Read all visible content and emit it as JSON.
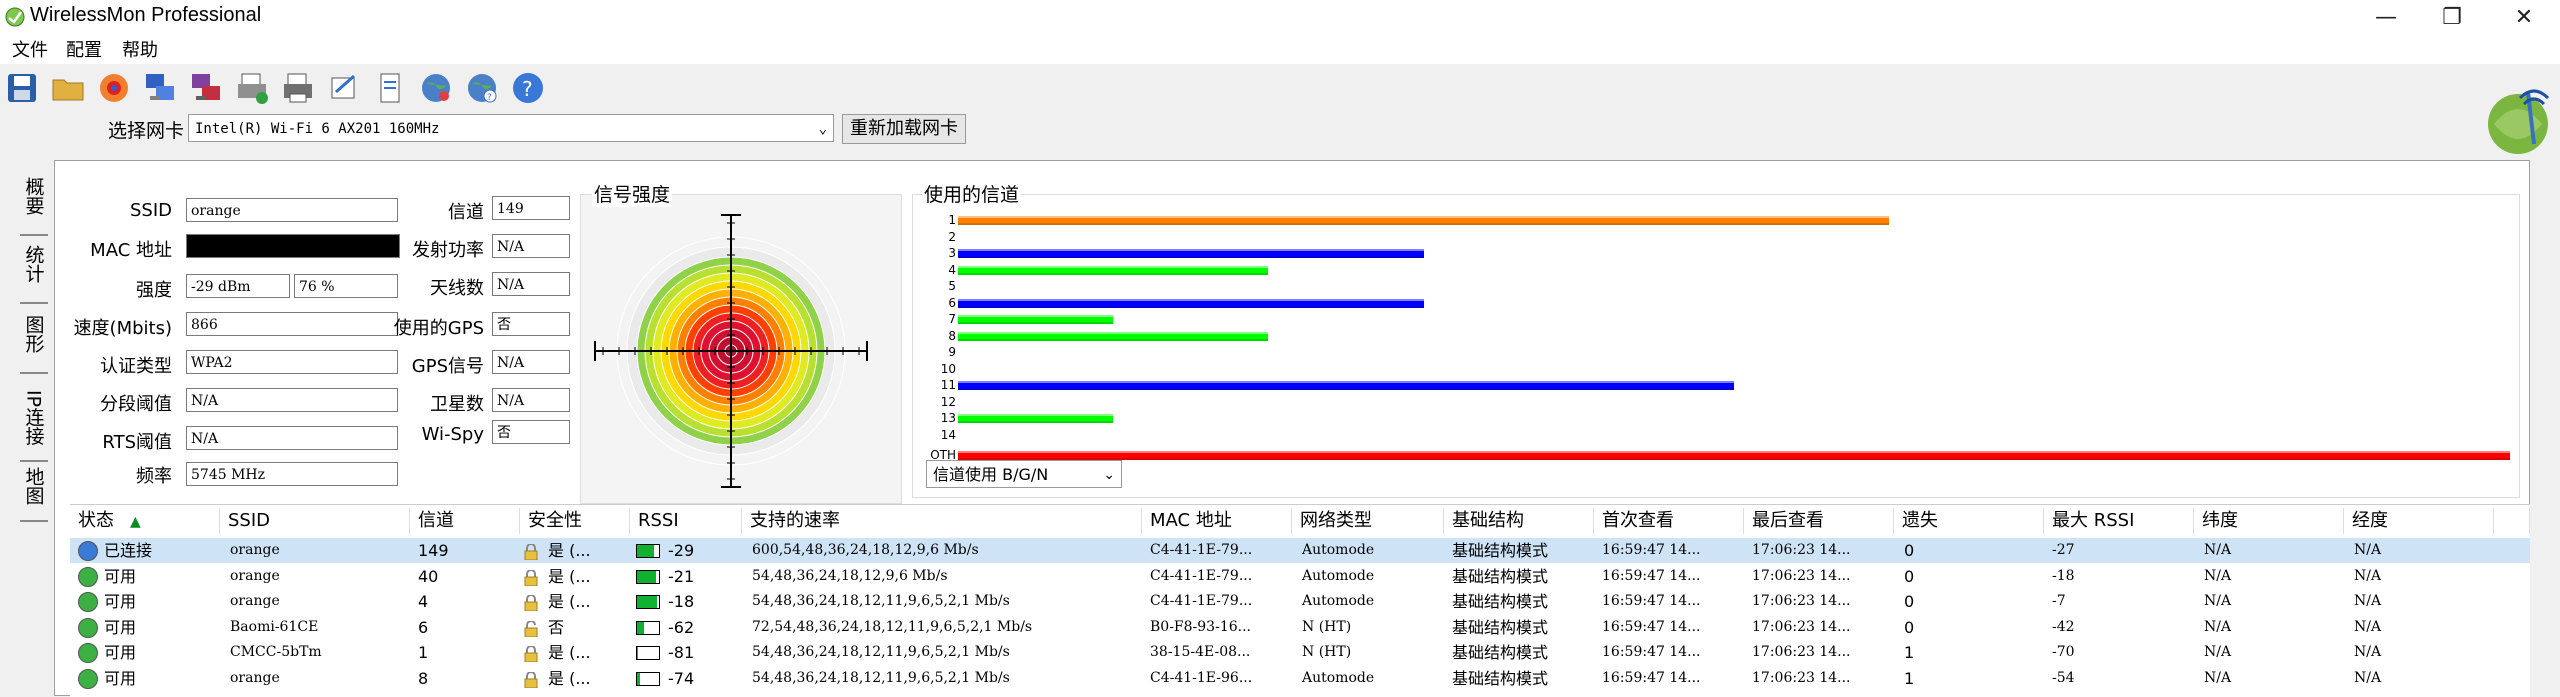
{
  "window": {
    "title": "WirelessMon Professional",
    "minimize": "—",
    "restore": "❐",
    "close": "✕"
  },
  "menu": [
    "文件",
    "配置",
    "帮助"
  ],
  "toolbar": {
    "icons": [
      "save-icon",
      "open-folder-icon",
      "record-icon",
      "network-icon",
      "network-color-icon",
      "print-icon",
      "printer-icon",
      "wizard-icon",
      "document-icon",
      "globe-icon",
      "globe-help-icon",
      "help-icon"
    ]
  },
  "adapter": {
    "label": "选择网卡",
    "value": "Intel(R) Wi-Fi 6 AX201 160MHz",
    "reload": "重新加载网卡"
  },
  "tabs": [
    "概要",
    "统计",
    "图形",
    "IP连接",
    "地图"
  ],
  "info": {
    "ssid_label": "SSID",
    "ssid": "orange",
    "mac_label": "MAC 地址",
    "mac": "",
    "strength_label": "强度",
    "strength_dbm": "-29 dBm",
    "strength_pct": "76 %",
    "speed_label": "速度(Mbits)",
    "speed": "866",
    "auth_label": "认证类型",
    "auth": "WPA2",
    "frag_label": "分段阈值",
    "frag": "N/A",
    "rts_label": "RTS阈值",
    "rts": "N/A",
    "freq_label": "频率",
    "freq": "5745 MHz",
    "channel_label": "信道",
    "channel": "149",
    "txpower_label": "发射功率",
    "txpower": "N/A",
    "antenna_label": "天线数",
    "antenna": "N/A",
    "gps_used_label": "使用的GPS",
    "gps_used": "否",
    "gps_signal_label": "GPS信号",
    "gps_signal": "N/A",
    "satellites_label": "卫星数",
    "satellites": "N/A",
    "wispy_label": "Wi-Spy",
    "wispy": "否"
  },
  "signal": {
    "title": "信号强度",
    "strength_pct": 76
  },
  "channels": {
    "title": "使用的信道",
    "labels": [
      "1",
      "2",
      "3",
      "4",
      "5",
      "6",
      "7",
      "8",
      "9",
      "10",
      "11",
      "12",
      "13",
      "14",
      "OTH"
    ],
    "usage": [
      6,
      0,
      3,
      2,
      0,
      3,
      1,
      2,
      0,
      0,
      5,
      0,
      1,
      0,
      10
    ],
    "max": 10,
    "colors": [
      "#ff8000",
      "",
      "#0000ff",
      "#00ff00",
      "",
      "#0000ff",
      "#00ff00",
      "#00ff00",
      "",
      "",
      "#0000ff",
      "",
      "#00ff00",
      "",
      "#ff0000"
    ],
    "filter": "信道使用 B/G/N"
  },
  "table": {
    "headers": [
      "状态",
      "SSID",
      "信道",
      "安全性",
      "RSSI",
      "支持的速率",
      "MAC 地址",
      "网络类型",
      "基础结构",
      "首次查看",
      "最后查看",
      "遗失",
      "最大 RSSI",
      "纬度",
      "经度",
      ""
    ],
    "sort_arrow": "▲",
    "rows": [
      {
        "status": "已连接",
        "status_color": "#3a7bd5",
        "ssid": "orange",
        "channel": "149",
        "secure": "是 (...",
        "lock": "locked",
        "rssi": "-29",
        "rssi_pct": 0.76,
        "rates": "600,54,48,36,24,18,12,9,6 Mb/s",
        "mac": "C4-41-1E-79...",
        "type": "Automode",
        "infra": "基础结构模式",
        "first": "16:59:47 14...",
        "last": "17:06:23 14...",
        "lost": "0",
        "max_rssi": "-27",
        "lat": "N/A",
        "lon": "N/A"
      },
      {
        "status": "可用",
        "status_color": "#3cb043",
        "ssid": "orange",
        "channel": "40",
        "secure": "是 (...",
        "lock": "locked",
        "rssi": "-21",
        "rssi_pct": 0.85,
        "rates": "54,48,36,24,18,12,9,6 Mb/s",
        "mac": "C4-41-1E-79...",
        "type": "Automode",
        "infra": "基础结构模式",
        "first": "16:59:47 14...",
        "last": "17:06:23 14...",
        "lost": "0",
        "max_rssi": "-18",
        "lat": "N/A",
        "lon": "N/A"
      },
      {
        "status": "可用",
        "status_color": "#3cb043",
        "ssid": "orange",
        "channel": "4",
        "secure": "是 (...",
        "lock": "locked",
        "rssi": "-18",
        "rssi_pct": 0.9,
        "rates": "54,48,36,24,18,12,11,9,6,5,2,1 Mb/s",
        "mac": "C4-41-1E-79...",
        "type": "Automode",
        "infra": "基础结构模式",
        "first": "16:59:47 14...",
        "last": "17:06:23 14...",
        "lost": "0",
        "max_rssi": "-7",
        "lat": "N/A",
        "lon": "N/A"
      },
      {
        "status": "可用",
        "status_color": "#3cb043",
        "ssid": "Baomi-61CE",
        "channel": "6",
        "secure": "否",
        "lock": "open",
        "rssi": "-62",
        "rssi_pct": 0.3,
        "rates": "72,54,48,36,24,18,12,11,9,6,5,2,1 Mb/s",
        "mac": "B0-F8-93-16...",
        "type": "N (HT)",
        "infra": "基础结构模式",
        "first": "16:59:47 14...",
        "last": "17:06:23 14...",
        "lost": "0",
        "max_rssi": "-42",
        "lat": "N/A",
        "lon": "N/A"
      },
      {
        "status": "可用",
        "status_color": "#3cb043",
        "ssid": "CMCC-5bTm",
        "channel": "1",
        "secure": "是 (...",
        "lock": "locked",
        "rssi": "-81",
        "rssi_pct": 0.05,
        "rates": "54,48,36,24,18,12,11,9,6,5,2,1 Mb/s",
        "mac": "38-15-4E-08...",
        "type": "N (HT)",
        "infra": "基础结构模式",
        "first": "16:59:47 14...",
        "last": "17:06:23 14...",
        "lost": "1",
        "max_rssi": "-70",
        "lat": "N/A",
        "lon": "N/A"
      },
      {
        "status": "可用",
        "status_color": "#3cb043",
        "ssid": "orange",
        "channel": "8",
        "secure": "是 (...",
        "lock": "locked",
        "rssi": "-74",
        "rssi_pct": 0.15,
        "rates": "54,48,36,24,18,12,11,9,6,5,2,1 Mb/s",
        "mac": "C4-41-1E-96...",
        "type": "Automode",
        "infra": "基础结构模式",
        "first": "16:59:47 14...",
        "last": "17:06:23 14...",
        "lost": "1",
        "max_rssi": "-54",
        "lat": "N/A",
        "lon": "N/A"
      }
    ]
  }
}
